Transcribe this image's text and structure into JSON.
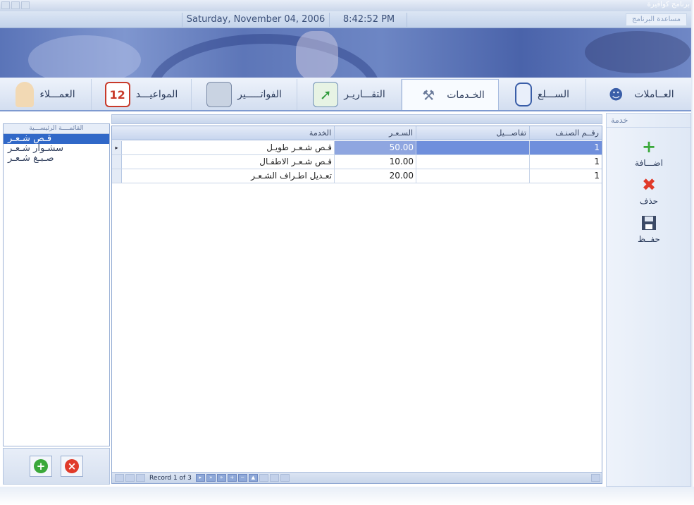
{
  "app": {
    "title": "برنامج كوافيرة",
    "help_menu": "مساعدة البرنامج",
    "date": "Saturday, November 04, 2006",
    "time": "8:42:52 PM"
  },
  "nav": {
    "tabs": [
      {
        "label": "العــاملات",
        "icon": "workers-icon"
      },
      {
        "label": "الســـلع",
        "icon": "bottle-icon"
      },
      {
        "label": "الخـدمات",
        "icon": "hairdryer-icon"
      },
      {
        "label": "التقـــاريـر",
        "icon": "chart-icon"
      },
      {
        "label": "الفواتـــــير",
        "icon": "cash-register-icon"
      },
      {
        "label": "المواعيـــد",
        "icon": "calendar-icon"
      },
      {
        "label": "العمـــلاء",
        "icon": "customer-icon"
      }
    ],
    "calendar_day": "12"
  },
  "left_list": {
    "header": "القائمــــة الرئيســـية",
    "items": [
      "قـص شـعـر",
      "سشـوار شـعـر",
      "صـبـغ شـعـر"
    ]
  },
  "grid": {
    "columns": [
      "الخدمة",
      "السـعـر",
      "تفاصـــيل",
      "رقــم الصنـف"
    ],
    "rows": [
      {
        "service": "قـص شـعـر طويـل",
        "price": "50.00",
        "details": "",
        "category": "1"
      },
      {
        "service": "قـص شـعـر الاطفـال",
        "price": "10.00",
        "details": "",
        "category": "1"
      },
      {
        "service": "تعـديل اطـراف الشـعـر",
        "price": "20.00",
        "details": "",
        "category": "1"
      }
    ],
    "navigator": {
      "record_text": "Record 1 of 3"
    }
  },
  "right_panel": {
    "header": "خدمة",
    "actions": [
      {
        "label": "اضـــافة",
        "icon": "plus-icon"
      },
      {
        "label": "حذف",
        "icon": "delete-icon"
      },
      {
        "label": "حفــظ",
        "icon": "save-icon"
      }
    ]
  },
  "colors": {
    "accent": "#3068c8",
    "selected_row": "#8fa6e0",
    "add_green": "#3aa83a",
    "delete_red": "#e03a2a"
  }
}
